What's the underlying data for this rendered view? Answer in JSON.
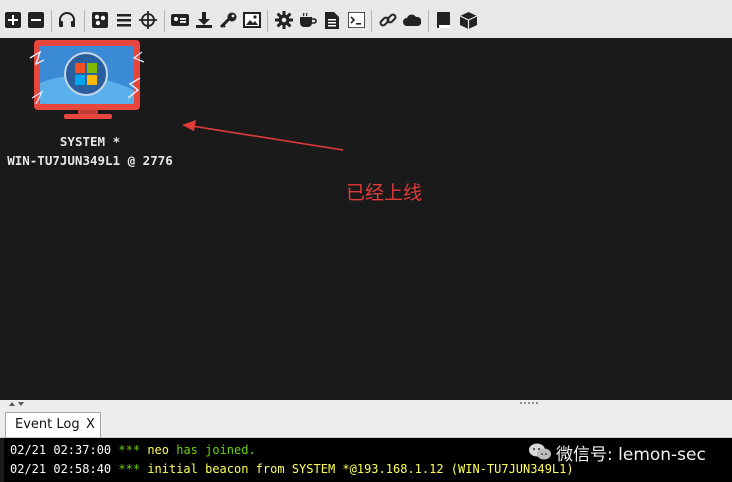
{
  "toolbar": {
    "icons": [
      "plus-icon",
      "minus-icon",
      "headphones-icon",
      "graph-view-icon",
      "list-view-icon",
      "target-icon",
      "id-card-icon",
      "download-icon",
      "key-icon",
      "image-icon",
      "gear-icon",
      "coffee-icon",
      "document-icon",
      "terminal-icon",
      "link-icon",
      "cloud-icon",
      "book-icon",
      "package-icon"
    ]
  },
  "session": {
    "user": "SYSTEM *",
    "host": "WIN-TU7JUN349L1 @ 2776"
  },
  "annotation": {
    "text": "已经上线",
    "color": "#e23a3a"
  },
  "event_log": {
    "tab_label": "Event Log",
    "tab_close": "X",
    "lines": [
      {
        "date": "02/21",
        "time": "02:37:00",
        "marker": "***",
        "user": "neo",
        "message": "has joined.",
        "extra": ""
      },
      {
        "date": "02/21",
        "time": "02:58:40",
        "marker": "***",
        "user": "",
        "message": "initial beacon from",
        "extra": "SYSTEM *@193.168.1.12 (WIN-TU7JUN349L1)"
      }
    ]
  },
  "watermark": {
    "text": "微信号: lemon-sec"
  },
  "colors": {
    "timestamp": "#ffffff",
    "marker": "#6bd100",
    "user": "#ffff55",
    "joined": "#6bd100",
    "beacon": "#ffff55",
    "monitor": "#e8453c"
  }
}
